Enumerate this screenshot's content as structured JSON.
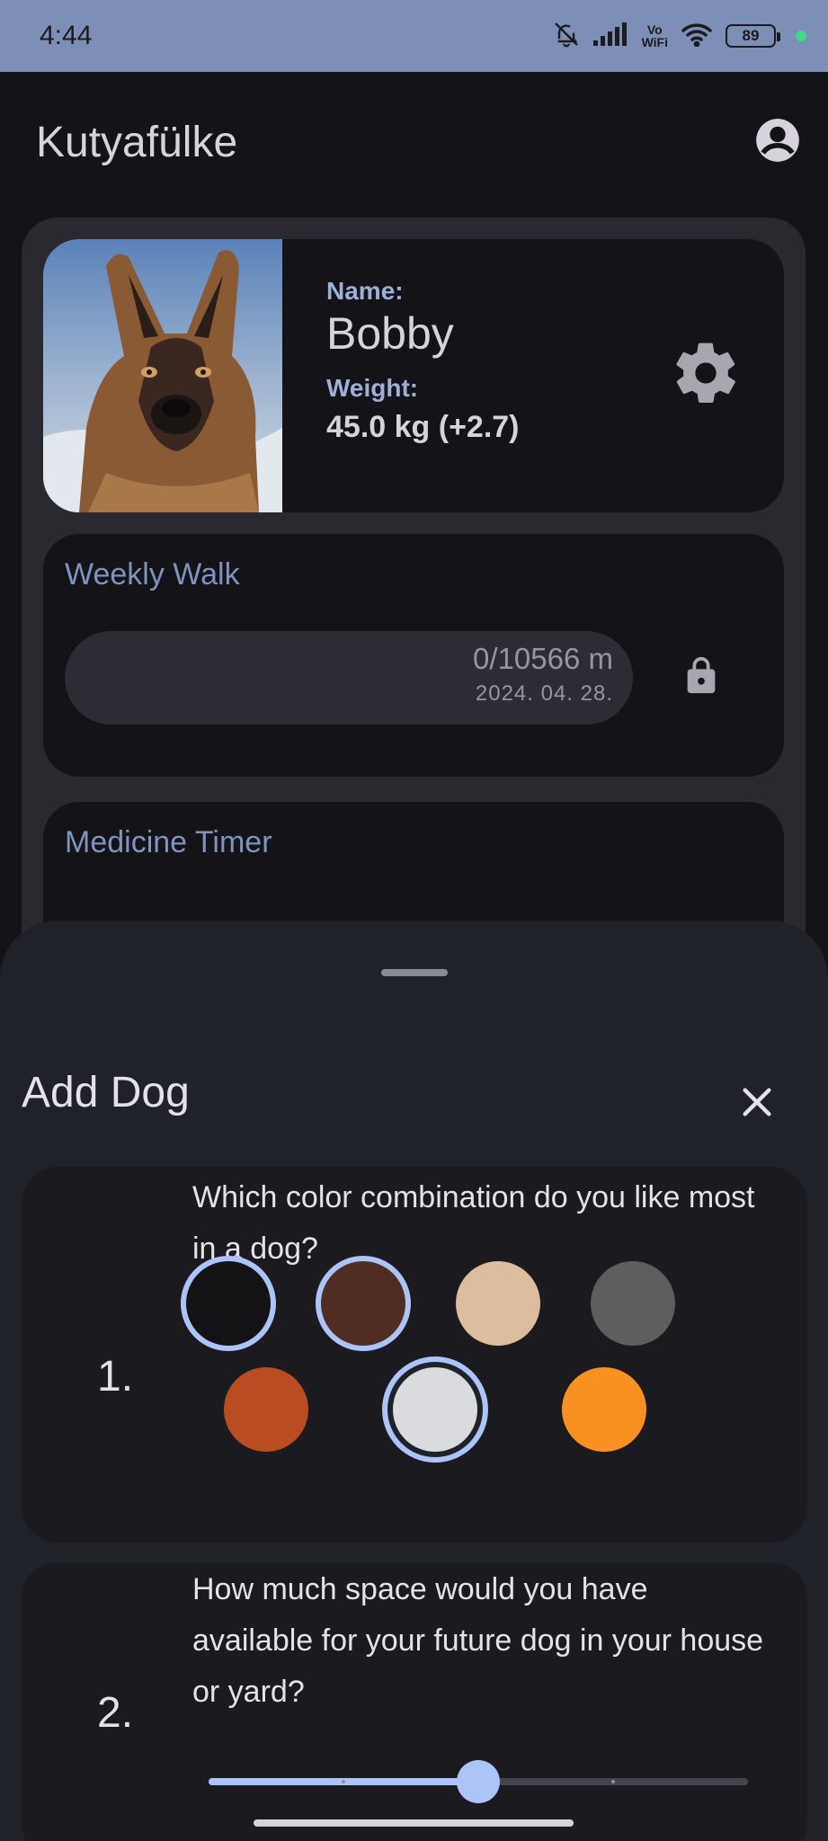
{
  "status_bar": {
    "time": "4:44",
    "vowifi_top": "Vo",
    "vowifi_bottom": "WiFi",
    "battery": "89",
    "icons": [
      "bell-off-icon",
      "signal-icon",
      "vowifi-icon",
      "wifi-icon",
      "battery-icon",
      "privacy-dot-icon"
    ]
  },
  "app_bar": {
    "title": "Kutyafülke",
    "profile_icon": "account-circle-icon"
  },
  "dog_card": {
    "name_label": "Name:",
    "name": "Bobby",
    "weight_label": "Weight:",
    "weight": "45.0 kg (+2.7)",
    "settings_icon": "gear-icon"
  },
  "walk_card": {
    "title": "Weekly Walk",
    "value": "0/10566 m",
    "date": "2024. 04. 28.",
    "progress": 0,
    "lock_icon": "lock-icon"
  },
  "medicine_card": {
    "title": "Medicine Timer"
  },
  "sheet": {
    "title": "Add Dog",
    "close_icon": "close-icon",
    "questions": [
      {
        "number": "1.",
        "text": "Which color combination do you like most in a dog?",
        "colors": [
          {
            "hex": "#131315",
            "selected": true
          },
          {
            "hex": "#4f2d22",
            "selected": true
          },
          {
            "hex": "#dcbd9e",
            "selected": false
          },
          {
            "hex": "#5e5e5e",
            "selected": false
          },
          {
            "hex": "#b94d21",
            "selected": false
          },
          {
            "hex": "#dadbdf",
            "selected": true
          },
          {
            "hex": "#f8911f",
            "selected": false
          }
        ]
      },
      {
        "number": "2.",
        "text": "How much space would you have available for your future dog in your house or yard?",
        "slider_value": 0.5,
        "slider_steps": 5
      }
    ]
  },
  "colors": {
    "accent": "#adc4f9",
    "status_bar": "#7d8fb6",
    "background": "#141318",
    "sheet": "#202229"
  }
}
